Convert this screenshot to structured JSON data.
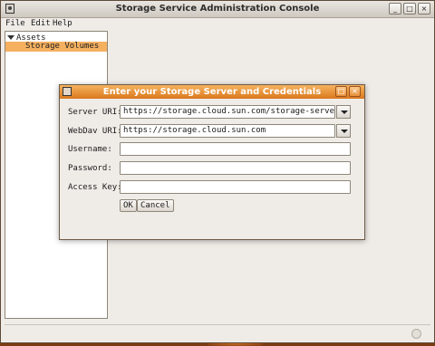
{
  "window": {
    "title": "Storage Service Administration Console",
    "controls": [
      "_",
      "□",
      "×"
    ]
  },
  "menubar": {
    "file": "File",
    "edit": "Edit",
    "help": "Help"
  },
  "tree": {
    "root_label": "Assets",
    "child_label": "Storage Volumes",
    "selected_color": "#f5b060"
  },
  "dialog": {
    "title": "Enter your Storage Server and Credentials",
    "fields": {
      "server_uri": {
        "label": "Server URI:",
        "value": "https://storage.cloud.sun.com/storage-server"
      },
      "webdav_uri": {
        "label": "WebDav URI:",
        "value": "https://storage.cloud.sun.com"
      },
      "username": {
        "label": "Username:",
        "value": ""
      },
      "password": {
        "label": "Password:",
        "value": ""
      },
      "access_key": {
        "label": "Access Key:",
        "value": ""
      }
    },
    "ok_label": "OK",
    "cancel_label": "Cancel",
    "titlebar_color": "#e08a2e"
  },
  "icons": [
    "app-icon",
    "dialog-icon",
    "tree-expand-arrow-icon",
    "combo-dropdown-icon",
    "status-indicator-icon"
  ]
}
